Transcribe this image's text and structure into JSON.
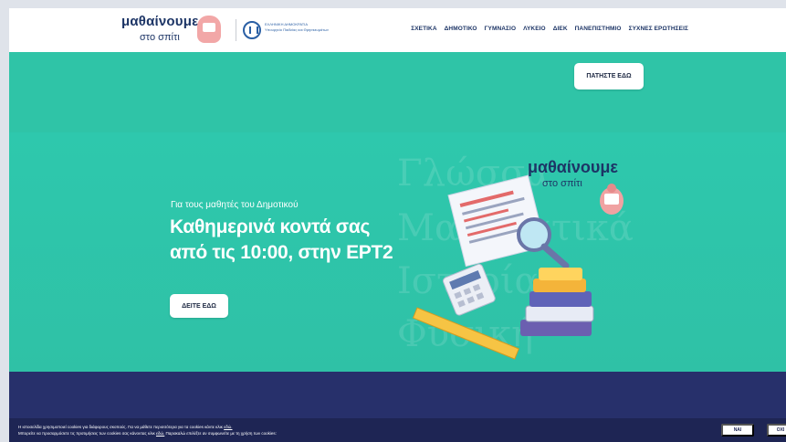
{
  "header": {
    "brand_line1": "μαθαίνουμε",
    "brand_line2": "στο σπίτι",
    "ministry_line1": "ΕΛΛΗΝΙΚΗ ΔΗΜΟΚΡΑΤΙΑ",
    "ministry_line2": "Υπουργείο Παιδείας και Θρησκευμάτων",
    "nav": [
      "ΣΧΕΤΙΚΑ",
      "ΔΗΜΟΤΙΚΟ",
      "ΓΥΜΝΑΣΙΟ",
      "ΛΥΚΕΙΟ",
      "ΔΙΕΚ",
      "ΠΑΝΕΠΙΣΤΗΜΙΟ",
      "ΣΥΧΝΕΣ ΕΡΩΤΗΣΕΙΣ"
    ]
  },
  "band1": {
    "button_label": "ΠΑΤΗΣΤΕ ΕΔΩ"
  },
  "hero": {
    "subtitle": "Για τους μαθητές του Δημοτικού",
    "title_line1": "Καθημερινά κοντά σας",
    "title_line2": "από τις 10:00, στην ΕΡΤ2",
    "button_label": "ΔΕΙΤΕ ΕΔΩ",
    "brand_line1": "μαθαίνουμε",
    "brand_line2": "στο σπίτι",
    "bg_words": [
      "Γλώσσα",
      "Μαθηματικά",
      "Ιστορία",
      "Φυσική"
    ]
  },
  "cookie": {
    "text_line1": "Η ιστοσελίδα χρησιμοποιεί cookies για διάφορους σκοπούς. Για να μάθετε περισσότερα για τα cookies κάντε κλικ",
    "link1": "εδώ.",
    "text_line2": "Μπορείτε να προσαρμόσετε τις προτιμήσεις των cookies σας κάνοντας κλικ",
    "link2": "εδώ.",
    "text_line2b": "Παρακαλώ επιλέξτε αν συμφωνείτε με τη χρήση των cookies:",
    "yes_label": "ΝΑΙ",
    "no_label": "ΟΧΙ"
  },
  "colors": {
    "teal": "#2fc4a7",
    "navy": "#27306b",
    "brand_text": "#1d3566"
  }
}
